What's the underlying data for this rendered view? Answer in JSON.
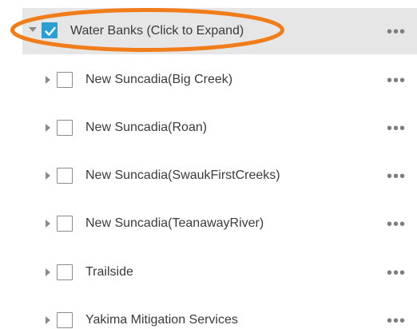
{
  "parent": {
    "label": "Water Banks (Click to Expand)",
    "checked": true,
    "expanded": true,
    "menu": "•••",
    "caret_icon": "chevron-down-icon",
    "checkbox_icon": "checkmark-icon"
  },
  "children": [
    {
      "label": "New Suncadia(Big Creek)",
      "checked": false,
      "menu": "•••"
    },
    {
      "label": "New Suncadia(Roan)",
      "checked": false,
      "menu": "•••"
    },
    {
      "label": "New Suncadia(SwaukFirstCreeks)",
      "checked": false,
      "menu": "•••"
    },
    {
      "label": "New Suncadia(TeanawayRiver)",
      "checked": false,
      "menu": "•••"
    },
    {
      "label": "Trailside",
      "checked": false,
      "menu": "•••"
    },
    {
      "label": "Yakima Mitigation Services",
      "checked": false,
      "menu": "•••"
    }
  ],
  "colors": {
    "checkbox_checked": "#2b9ed4",
    "selected_row_bg": "#e6e6e6",
    "highlight_ellipse": "#f07c1a"
  }
}
